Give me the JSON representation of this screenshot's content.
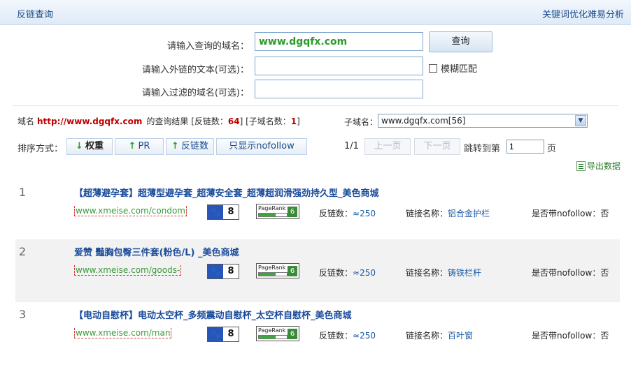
{
  "header": {
    "title": "反链查询",
    "right_link": "关键词优化难易分析"
  },
  "form": {
    "domain_label": "请输入查询的域名：",
    "domain_value": "www.dgqfx.com",
    "anchor_label": "请输入外链的文本(可选)：",
    "anchor_value": "",
    "filter_label": "请输入过滤的域名(可选)：",
    "filter_value": "",
    "query_button": "查询",
    "fuzzy_label": "模糊匹配"
  },
  "result": {
    "prefix": "域名",
    "domain": "http://www.dgqfx.com",
    "mid": "的查询结果 [反链数：",
    "backlinks": "64",
    "mid2": "] [子域名数：",
    "subdomains": "1",
    "suffix": "]",
    "subdomain_label": "子域名：",
    "subdomain_selected": "www.dgqfx.com[56]"
  },
  "sort": {
    "label": "排序方式：",
    "buttons": [
      "权重",
      "PR",
      "反链数",
      "只显示nofollow"
    ]
  },
  "pager": {
    "info": "1/1",
    "prev": "上一页",
    "next": "下一页",
    "jump_label": "跳转到第",
    "page_value": "1",
    "page_suffix": "页"
  },
  "export_label": "导出数据",
  "rows": [
    {
      "index": "1",
      "title": "【超薄避孕套】超薄型避孕套_超薄安全套_超薄超润滑强劲持久型_美色商城",
      "url": "www.xmeise.com/condom",
      "baidu_weight": "8",
      "pr_label": "PageRank",
      "pr": "6",
      "backlinks_label": "反链数：",
      "backlinks": "≈250",
      "anchor_label": "链接名称：",
      "anchor": "铝合金护栏",
      "nofollow_label": "是否带nofollow：",
      "nofollow": "否"
    },
    {
      "index": "2",
      "title": "爱赞 豔胸包臀三件套(粉色/L) _美色商城",
      "url": "www.xmeise.com/goods-",
      "baidu_weight": "8",
      "pr_label": "PageRank",
      "pr": "6",
      "backlinks_label": "反链数：",
      "backlinks": "≈250",
      "anchor_label": "链接名称：",
      "anchor": "铸铁栏杆",
      "nofollow_label": "是否带nofollow：",
      "nofollow": "否"
    },
    {
      "index": "3",
      "title": "【电动自慰杯】电动太空杯_多频震动自慰杯_太空杯自慰杯_美色商城",
      "url": "www.xmeise.com/man",
      "baidu_weight": "8",
      "pr_label": "PageRank",
      "pr": "6",
      "backlinks_label": "反链数：",
      "backlinks": "≈250",
      "anchor_label": "链接名称：",
      "anchor": "百叶窗",
      "nofollow_label": "是否带nofollow：",
      "nofollow": "否"
    }
  ]
}
